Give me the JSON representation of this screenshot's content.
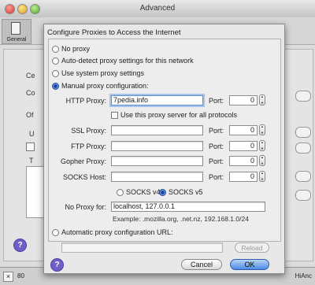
{
  "window": {
    "title": "Advanced"
  },
  "toolbar": {
    "general_label": "General"
  },
  "background": {
    "frag_ce": "Ce",
    "frag_co": "Co",
    "frag_of": "Of",
    "frag_u": "U",
    "frag_t": "T",
    "status_count": "80",
    "status_right": "HiAnc"
  },
  "dialog": {
    "heading": "Configure Proxies to Access the Internet",
    "options": {
      "no_proxy": "No proxy",
      "auto_detect": "Auto-detect proxy settings for this network",
      "system": "Use system proxy settings",
      "manual": "Manual proxy configuration:",
      "auto_url": "Automatic proxy configuration URL:"
    },
    "selected_option": "manual",
    "http": {
      "label": "HTTP Proxy:",
      "value": "7pedia.info",
      "port_label": "Port:",
      "port": "0"
    },
    "same_proxy_label": "Use this proxy server for all protocols",
    "ssl": {
      "label": "SSL Proxy:",
      "value": "",
      "port_label": "Port:",
      "port": "0"
    },
    "ftp": {
      "label": "FTP Proxy:",
      "value": "",
      "port_label": "Port:",
      "port": "0"
    },
    "gopher": {
      "label": "Gopher Proxy:",
      "value": "",
      "port_label": "Port:",
      "port": "0"
    },
    "socks": {
      "label": "SOCKS Host:",
      "value": "",
      "port_label": "Port:",
      "port": "0"
    },
    "socks_v4": "SOCKS v4",
    "socks_v5": "SOCKS v5",
    "socks_selected": "v5",
    "no_proxy_for": {
      "label": "No Proxy for:",
      "value": "localhost, 127.0.0.1"
    },
    "example": "Example: .mozilla.org, .net.nz, 192.168.1.0/24",
    "auto_url_value": "",
    "reload_label": "Reload",
    "help_label": "?",
    "cancel_label": "Cancel",
    "ok_label": "OK"
  }
}
